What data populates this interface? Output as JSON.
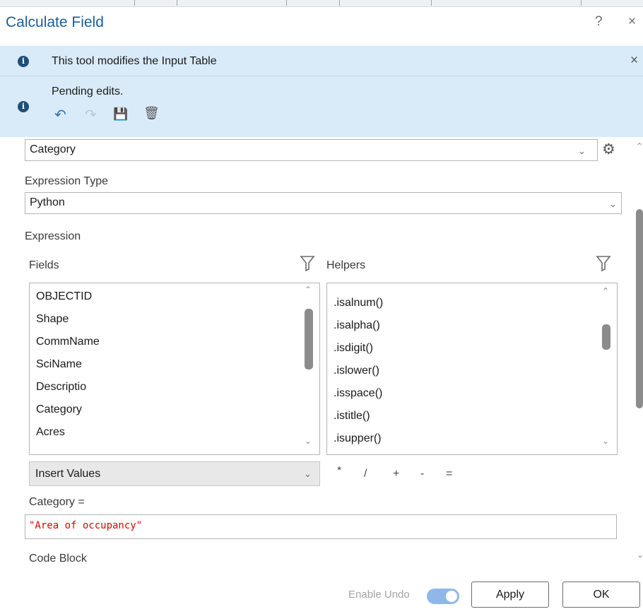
{
  "dialog": {
    "title": "Calculate Field",
    "help": "?",
    "close": "×"
  },
  "notice_modifies": {
    "text": "This tool modifies the Input Table",
    "dismiss": "×"
  },
  "pending": {
    "text": "Pending edits.",
    "tools": [
      {
        "name": "undo-icon",
        "glyph": "↶"
      },
      {
        "name": "redo-icon",
        "glyph": "↷"
      },
      {
        "name": "save-edits-icon",
        "glyph": "💾"
      },
      {
        "name": "discard-edits-icon",
        "glyph": "🗑"
      }
    ]
  },
  "field_name": {
    "value": "Category",
    "settings_glyph": "⚙"
  },
  "expression_type": {
    "label": "Expression Type",
    "value": "Python"
  },
  "expression": {
    "label": "Expression",
    "fields_label": "Fields",
    "helpers_label": "Helpers",
    "fields": [
      "OBJECTID",
      "Shape",
      "CommName",
      "SciName",
      "Descriptio",
      "Category",
      "Acres"
    ],
    "helpers": [
      ".isalnum()",
      ".isalpha()",
      ".isdigit()",
      ".islower()",
      ".isspace()",
      ".istitle()",
      ".isupper()"
    ],
    "insert_values": "Insert Values",
    "operators": [
      "*",
      "/",
      "+",
      "-",
      "="
    ],
    "target_label": "Category =",
    "expression_value": "\"Area of occupancy\""
  },
  "code_block": {
    "label": "Code Block"
  },
  "footer": {
    "enable_undo": "Enable Undo",
    "apply": "Apply",
    "ok": "OK"
  },
  "colors": {
    "title": "#1b5e96",
    "info_bg": "#d9ebf8",
    "accent": "#2c6fb5",
    "expression_text": "#e00000"
  }
}
